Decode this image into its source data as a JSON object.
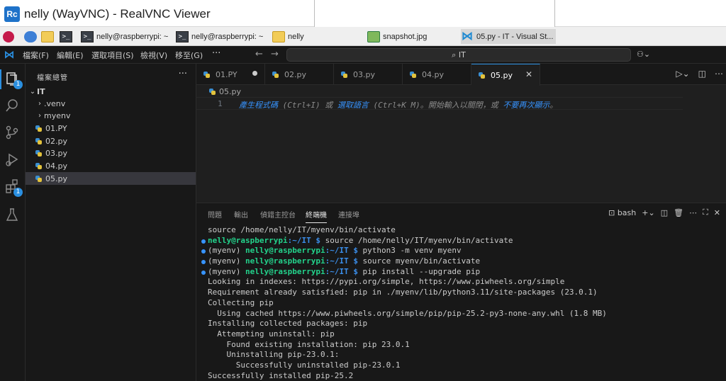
{
  "vnc": {
    "title": "nelly (WayVNC) - RealVNC Viewer",
    "logo_text": "Rc"
  },
  "taskbar": {
    "items": [
      {
        "label": "nelly@raspberrypi: ~"
      },
      {
        "label": "nelly@raspberrypi: ~"
      },
      {
        "label": "nelly"
      },
      {
        "label": "snapshot.jpg"
      },
      {
        "label": "05.py - IT - Visual St..."
      }
    ]
  },
  "menubar": {
    "items": [
      "檔案(F)",
      "編輯(E)",
      "選取項目(S)",
      "檢視(V)",
      "移至(G)"
    ],
    "search_text": "IT",
    "overflow": "···"
  },
  "activity": {
    "explorer_badge": "1",
    "extensions_badge": "1"
  },
  "sidebar": {
    "title": "檔案總管",
    "more": "···",
    "root": "IT",
    "folders": [
      ".venv",
      "myenv"
    ],
    "files": [
      "01.PY",
      "02.py",
      "03.py",
      "04.py",
      "05.py"
    ]
  },
  "tabs": [
    {
      "label": "01.PY"
    },
    {
      "label": "02.py"
    },
    {
      "label": "03.py"
    },
    {
      "label": "04.py"
    },
    {
      "label": "05.py"
    }
  ],
  "editor": {
    "breadcrumb": "05.py",
    "line_number": "1",
    "hint": {
      "p1": "產生程式碼",
      "p2": " (Ctrl+I) 或 ",
      "p3": "選取語言",
      "p4": " (Ctrl+K M)。開始輸入以關閉，或 ",
      "p5": "不要再次顯示",
      "p6": "。"
    }
  },
  "panel": {
    "tabs": [
      "問題",
      "輸出",
      "偵錯主控台",
      "終端機",
      "連接埠"
    ],
    "active_tab": "終端機",
    "shell": "bash"
  },
  "terminal": {
    "lines": [
      {
        "text": "source /home/nelly/IT/myenv/bin/activate"
      },
      {
        "user": "nelly@raspberrypi",
        "path": ":~/IT $",
        "cmd": " source /home/nelly/IT/myenv/bin/activate"
      },
      {
        "env": "(myenv) ",
        "user": "nelly@raspberrypi",
        "path": ":~/IT $",
        "cmd": " python3 -m venv myenv"
      },
      {
        "env": "(myenv) ",
        "user": "nelly@raspberrypi",
        "path": ":~/IT $",
        "cmd": " source myenv/bin/activate"
      },
      {
        "env": "(myenv) ",
        "user": "nelly@raspberrypi",
        "path": ":~/IT $",
        "cmd": " pip install --upgrade pip"
      },
      {
        "text": "Looking in indexes: https://pypi.org/simple, https://www.piwheels.org/simple"
      },
      {
        "text": "Requirement already satisfied: pip in ./myenv/lib/python3.11/site-packages (23.0.1)"
      },
      {
        "text": "Collecting pip"
      },
      {
        "text": "  Using cached https://www.piwheels.org/simple/pip/pip-25.2-py3-none-any.whl (1.8 MB)"
      },
      {
        "text": "Installing collected packages: pip"
      },
      {
        "text": "  Attempting uninstall: pip"
      },
      {
        "text": "    Found existing installation: pip 23.0.1"
      },
      {
        "text": "    Uninstalling pip-23.0.1:"
      },
      {
        "text": "      Successfully uninstalled pip-23.0.1"
      },
      {
        "text": "Successfully installed pip-25.2"
      }
    ]
  }
}
